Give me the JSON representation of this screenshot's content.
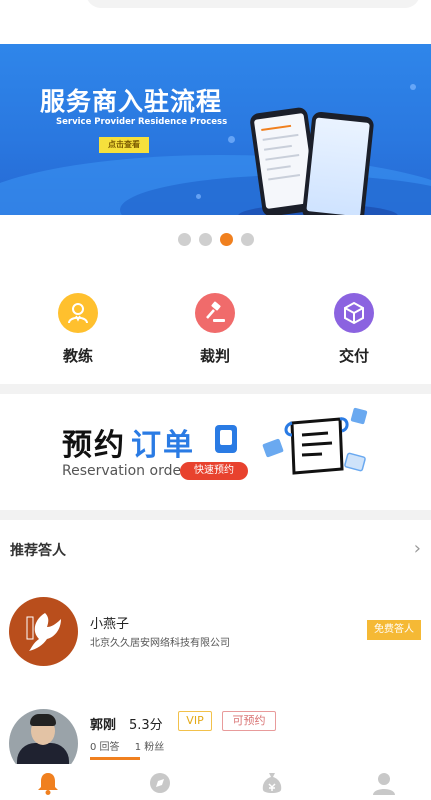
{
  "banner": {
    "title": "服务商入驻流程",
    "subtitle": "Service Provider Residence Process",
    "button": "点击查看"
  },
  "pager": {
    "count": 4,
    "active_index": 2
  },
  "categories": [
    {
      "label": "教练",
      "icon": "coach-icon",
      "color": "#ffc02e"
    },
    {
      "label": "裁判",
      "icon": "judge-icon",
      "color": "#f06b6b"
    },
    {
      "label": "交付",
      "icon": "delivery-icon",
      "color": "#8b63e0"
    }
  ],
  "reservation": {
    "title_black": "预约",
    "title_blue": "订单",
    "subtitle": "Reservation order",
    "button": "快速预约"
  },
  "recommend": {
    "title": "推荐答人",
    "items": [
      {
        "name": "小燕子",
        "company": "北京久久居安网络科技有限公司",
        "badge": "免费答人"
      },
      {
        "name": "郭刚",
        "score": "5.3分",
        "tags": [
          "VIP",
          "可预约"
        ],
        "answers": "0 回答",
        "fans": "1 粉丝"
      }
    ]
  },
  "tabbar": {
    "items": [
      "bell-icon",
      "compass-icon",
      "money-bag-icon",
      "user-icon"
    ],
    "active_index": 0,
    "active_color": "#f0801f",
    "inactive_color": "#c8c8c8"
  }
}
